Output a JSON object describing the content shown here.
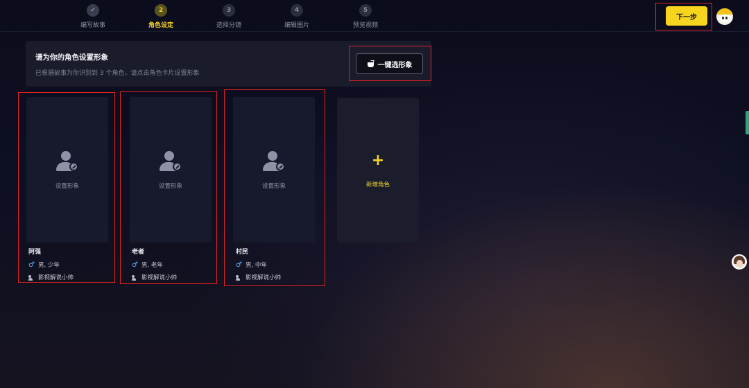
{
  "steps": [
    {
      "num": "✓",
      "label": "编写故事",
      "state": "done"
    },
    {
      "num": "2",
      "label": "角色设定",
      "state": "active"
    },
    {
      "num": "3",
      "label": "选择分镜",
      "state": "todo"
    },
    {
      "num": "4",
      "label": "编辑图片",
      "state": "todo"
    },
    {
      "num": "5",
      "label": "预览视频",
      "state": "todo"
    }
  ],
  "header": {
    "next_label": "下一步"
  },
  "panel": {
    "title": "请为你的角色设置形象",
    "desc": "已根据故事为你识别到 3 个角色，请点击角色卡片设置形象",
    "oneclick_label": "一键选形象"
  },
  "characters": [
    {
      "card_label": "设置形象",
      "name": "阿强",
      "gender_age": "男, 少年",
      "voice": "影视解说小帅"
    },
    {
      "card_label": "设置形象",
      "name": "老者",
      "gender_age": "男, 老年",
      "voice": "影视解说小帅"
    },
    {
      "card_label": "设置形象",
      "name": "村民",
      "gender_age": "男, 中年",
      "voice": "影视解说小帅"
    }
  ],
  "add_card": {
    "plus": "+",
    "label": "新增角色"
  },
  "icons": {
    "male": "♂"
  },
  "colors": {
    "accent": "#f7d51e",
    "highlight_box": "#e32222",
    "male_icon": "#5fb0ff"
  }
}
